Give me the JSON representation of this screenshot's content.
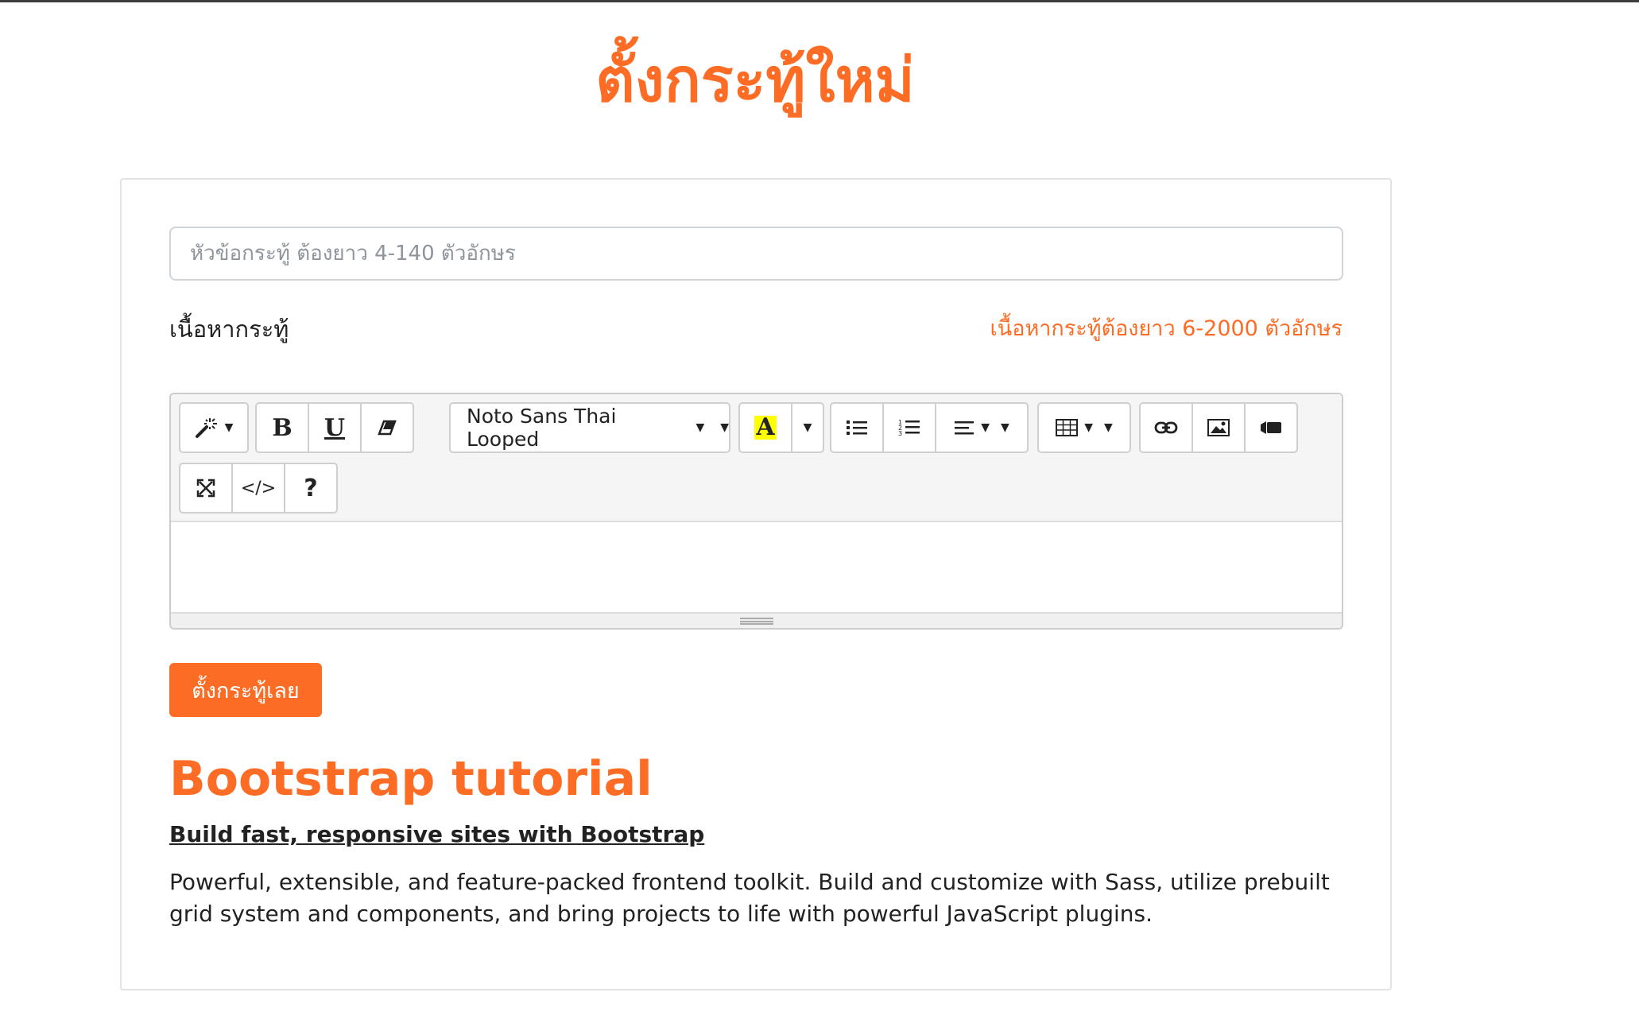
{
  "page": {
    "title": "ตั้งกระทู้ใหม่"
  },
  "form": {
    "title_placeholder": "หัวข้อกระทู้ ต้องยาว 4-140 ตัวอักษร",
    "content_label": "เนื้อหากระทู้",
    "content_hint": "เนื้อหากระทู้ต้องยาว 6-2000 ตัวอักษร",
    "submit_label": "ตั้งกระทู้เลย"
  },
  "toolbar": {
    "bold_label": "B",
    "underline_label": "U",
    "font_name": "Noto Sans Thai Looped",
    "color_letter": "A",
    "highlight_color": "#ffff00",
    "help_label": "?",
    "code_label": "</>",
    "icons": [
      "magic-icon",
      "bold-icon",
      "underline-icon",
      "eraser-icon",
      "font-family",
      "text-color-icon",
      "unordered-list-icon",
      "ordered-list-icon",
      "align-icon",
      "table-icon",
      "link-icon",
      "picture-icon",
      "video-icon",
      "fullscreen-icon",
      "code-view-icon",
      "help-icon"
    ]
  },
  "content": {
    "heading": "Bootstrap tutorial",
    "subheading": "Build fast, responsive sites with Bootstrap",
    "description": "Powerful, extensible, and feature-packed frontend toolkit. Build and customize with Sass, utilize prebuilt grid system and components, and bring projects to life with powerful JavaScript plugins."
  },
  "colors": {
    "accent": "#fd6c25",
    "border": "#cccccc",
    "toolbar_bg": "#f5f5f5"
  }
}
